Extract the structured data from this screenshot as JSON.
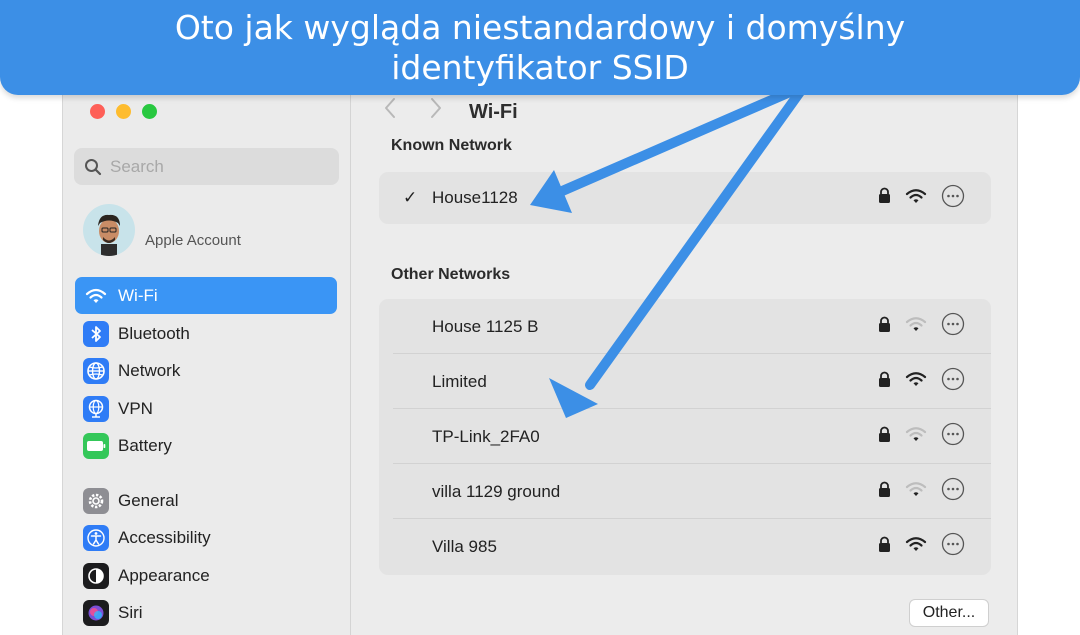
{
  "banner": {
    "text": "Oto jak wygląda niestandardowy i domyślny identyfikator SSID"
  },
  "sidebar": {
    "search_placeholder": "Search",
    "account_label": "Apple Account",
    "items": [
      {
        "label": "Wi-Fi",
        "icon": "wifi-icon",
        "color": "#ffffff",
        "selected": true
      },
      {
        "label": "Bluetooth",
        "icon": "bluetooth-icon",
        "color": "#2f7cf6"
      },
      {
        "label": "Network",
        "icon": "globe-icon",
        "color": "#2f7cf6"
      },
      {
        "label": "VPN",
        "icon": "vpn-globe-icon",
        "color": "#2f7cf6"
      },
      {
        "label": "Battery",
        "icon": "battery-icon",
        "color": "#34c759"
      },
      {
        "label": "General",
        "icon": "gear-icon",
        "color": "#8e8e93"
      },
      {
        "label": "Accessibility",
        "icon": "accessibility-icon",
        "color": "#2f7cf6"
      },
      {
        "label": "Appearance",
        "icon": "appearance-icon",
        "color": "#1c1c1e"
      },
      {
        "label": "Siri",
        "icon": "siri-icon",
        "color": "#1c1c1e"
      }
    ]
  },
  "content": {
    "title": "Wi-Fi",
    "known_header": "Known Network",
    "other_header": "Other Networks",
    "known_networks": [
      {
        "ssid": "House1128",
        "connected": true,
        "signal": "strong"
      }
    ],
    "other_networks": [
      {
        "ssid": "House 1125 B",
        "signal": "weak"
      },
      {
        "ssid": "Limited",
        "signal": "strong"
      },
      {
        "ssid": "TP-Link_2FA0",
        "signal": "weak"
      },
      {
        "ssid": "villa 1129 ground",
        "signal": "weak"
      },
      {
        "ssid": "Villa 985",
        "signal": "strong"
      }
    ],
    "other_button": "Other...",
    "check_glyph": "✓"
  },
  "colors": {
    "accent": "#3a95f5",
    "banner": "#3c8fe6",
    "arrow": "#3c8fe6"
  }
}
